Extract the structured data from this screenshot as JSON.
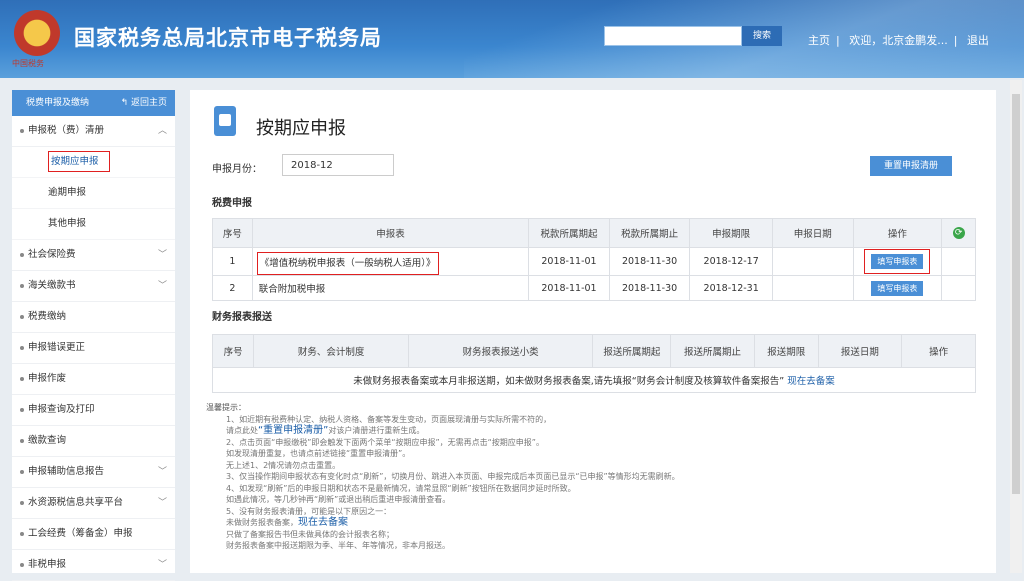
{
  "header": {
    "emblem_caption": "中国税务",
    "title": "国家税务总局北京市电子税务局",
    "search_placeholder": "",
    "search_label": "搜索",
    "home_link": "主页",
    "welcome": "欢迎，北京金鹏发...",
    "logout": "退出"
  },
  "sidebar": {
    "heading": "税费申报及缴纳",
    "back_label": "返回主页",
    "items": [
      {
        "label": "申报税（费）清册",
        "expanded": true,
        "children": [
          "按期应申报",
          "逾期申报",
          "其他申报"
        ]
      },
      {
        "label": "社会保险费"
      },
      {
        "label": "海关缴款书"
      },
      {
        "label": "税费缴纳"
      },
      {
        "label": "申报错误更正"
      },
      {
        "label": "申报作废"
      },
      {
        "label": "申报查询及打印"
      },
      {
        "label": "缴款查询"
      },
      {
        "label": "申报辅助信息报告"
      },
      {
        "label": "水资源税信息共享平台"
      },
      {
        "label": "工会经费（筹备金）申报"
      },
      {
        "label": "非税申报"
      }
    ]
  },
  "main": {
    "title": "按期应申报",
    "month_label": "申报月份：",
    "month_value": "2018-12",
    "reset_button": "重置申报清册",
    "tax_section": "税费申报",
    "tax_headers": [
      "序号",
      "申报表",
      "税款所属期起",
      "税款所属期止",
      "申报期限",
      "申报日期",
      "操作"
    ],
    "tax_rows": [
      {
        "no": "1",
        "form": "《增值税纳税申报表（一般纳税人适用）》",
        "start": "2018-11-01",
        "end": "2018-11-30",
        "deadline": "2018-12-17",
        "date": "",
        "op": "填写申报表"
      },
      {
        "no": "2",
        "form": "联合附加税申报",
        "start": "2018-11-01",
        "end": "2018-11-30",
        "deadline": "2018-12-31",
        "date": "",
        "op": "填写申报表"
      }
    ],
    "fin_section": "财务报表报送",
    "fin_headers": [
      "序号",
      "财务、会计制度",
      "财务报表报送小类",
      "报送所属期起",
      "报送所属期止",
      "报送期限",
      "报送日期",
      "操作"
    ],
    "fin_notice": "未做财务报表备案或本月非报送期，如未做财务报表备案,请先填报“财务会计制度及核算软件备案报告”",
    "fin_link": "现在去备案"
  },
  "notes": {
    "heading": "温馨提示：",
    "l1": "1、如近期有税费种认定、纳税人资格、备案等发生变动，页面展现清册与实际所需不符的，",
    "l1b": "请点此处",
    "l1_link": "“重置申报清册”",
    "l1c": "对该户清册进行重新生成。",
    "l2": "2、点击页面“申报缴税”即会触发下面两个菜单“按期应申报”，无需再点击“按期应申报”。",
    "l2b": "如发现清册重复，也请点前述链接“重置申报清册”。",
    "l2c": "无上述1、2情况请勿点击重置。",
    "l3": "3、仅当操作期间申报状态有变化时点“刷新”，切换月份、跳进入本页面、申报完成后本页面已显示“已申报”等情形均无需刷新。",
    "l4": "4、如发现“刷新”后的申报日期和状态不是最新情况，请常显照“刷新”按钮所在数据同步延时所致。",
    "l4b": "如遇此情况，等几秒钟再“刷新”或退出稍后重进申报清册查看。",
    "l5": "5、没有财务报表清册，可能是以下原因之一：",
    "l5a": "未做财务报表备案，",
    "l5a_link": "现在去备案",
    "l5b": "只做了备案报告书但未做具体的会计报表名称；",
    "l5c": "财务报表备案中报送期限为季、半年、年等情况，非本月报送。"
  }
}
